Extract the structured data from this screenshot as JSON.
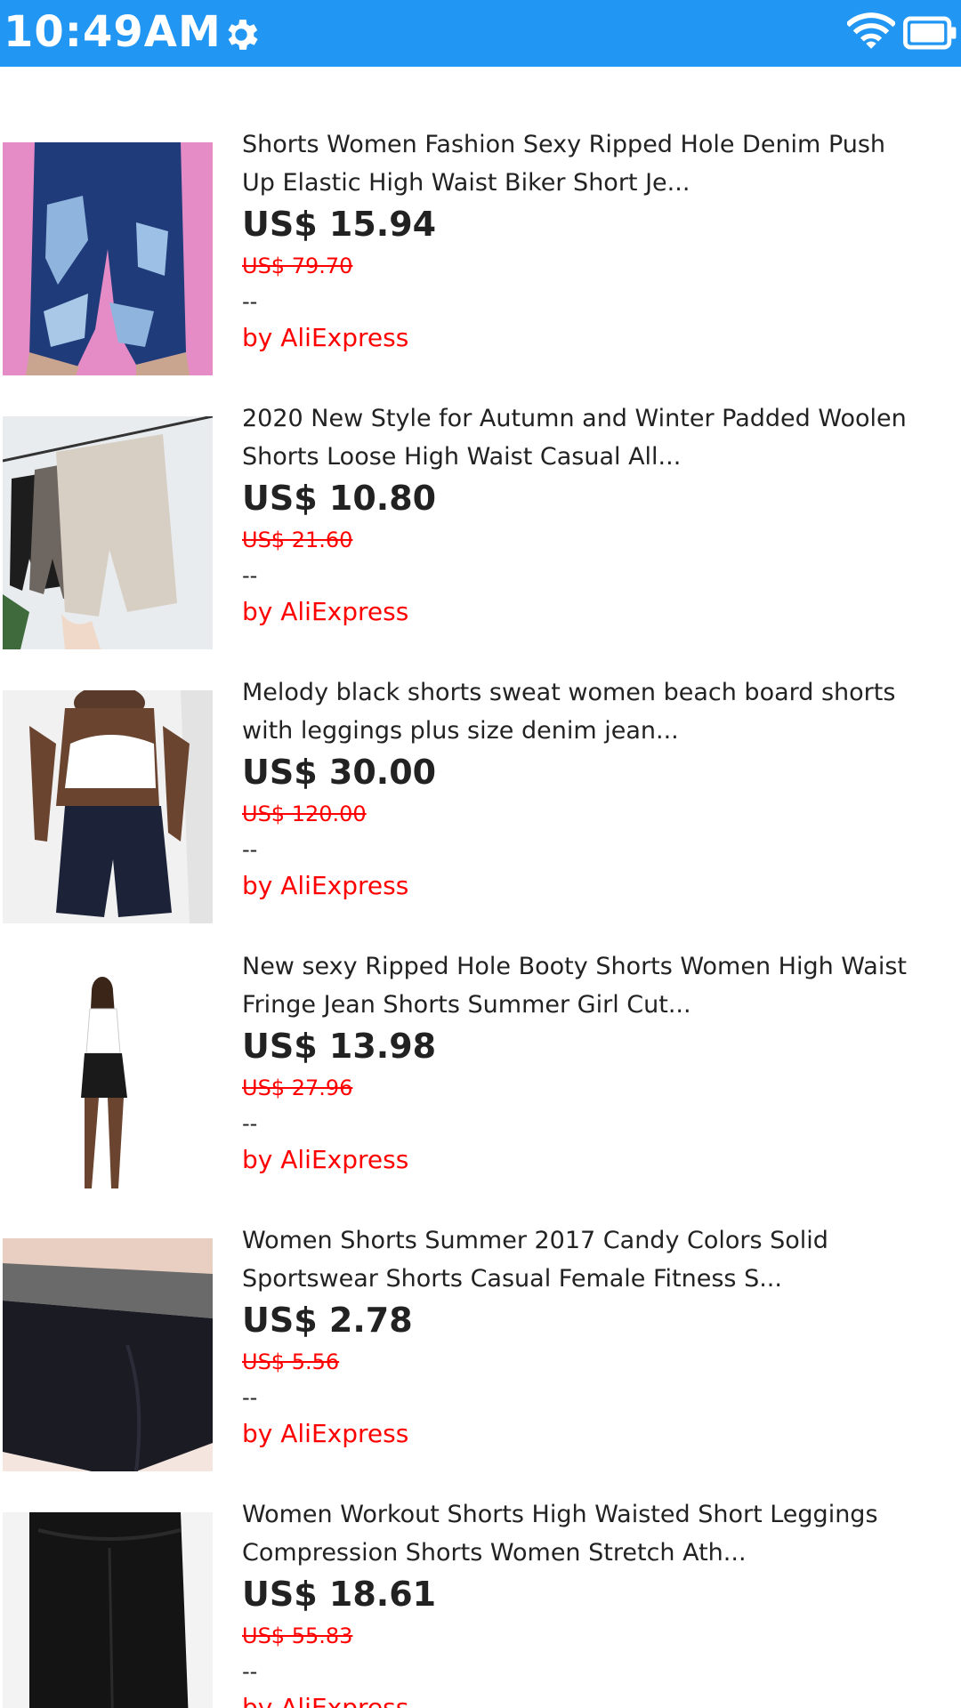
{
  "status_bar": {
    "time": "10:49AM",
    "icons": [
      "gear-icon",
      "wifi-icon",
      "battery-icon"
    ],
    "bg_color": "#2196f3"
  },
  "products": [
    {
      "title_line1": "Shorts Women Fashion Sexy Ripped Hole Denim Push",
      "title_line2": "Up Elastic High Waist Biker Short Je...",
      "price": "US$ 15.94",
      "old_price": "US$ 79.70",
      "rating": "--",
      "seller": "by AliExpress"
    },
    {
      "title_line1": "2020 New Style for Autumn and Winter Padded Woolen",
      "title_line2": "Shorts Loose High Waist Casual All...",
      "price": "US$ 10.80",
      "old_price": "US$ 21.60",
      "rating": "--",
      "seller": "by AliExpress"
    },
    {
      "title_line1": "Melody black shorts sweat women beach board shorts",
      "title_line2": "with leggings plus size denim jean...",
      "price": "US$ 30.00",
      "old_price": "US$ 120.00",
      "rating": "--",
      "seller": "by AliExpress"
    },
    {
      "title_line1": "New sexy Ripped Hole Booty Shorts Women High Waist",
      "title_line2": "Fringe Jean Shorts Summer Girl Cut...",
      "price": "US$ 13.98",
      "old_price": "US$ 27.96",
      "rating": "--",
      "seller": "by AliExpress"
    },
    {
      "title_line1": "Women Shorts Summer 2017 Candy Colors Solid",
      "title_line2": "Sportswear Shorts Casual Female Fitness S...",
      "price": "US$ 2.78",
      "old_price": "US$ 5.56",
      "rating": "--",
      "seller": "by AliExpress"
    },
    {
      "title_line1": "Women Workout Shorts High Waisted Short Leggings",
      "title_line2": "Compression Shorts Women Stretch Ath...",
      "price": "US$ 18.61",
      "old_price": "US$ 55.83",
      "rating": "--",
      "seller": "by AliExpress"
    }
  ],
  "colors": {
    "accent_red": "#ff0000",
    "text": "#222222"
  }
}
